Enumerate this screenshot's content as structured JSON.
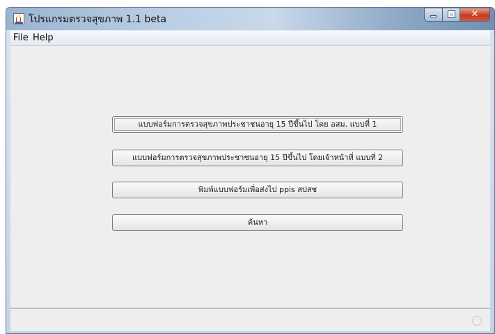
{
  "window": {
    "title": "โปรแกรมตรวจสุขภาพ 1.1 beta",
    "app_icon": "java-cup-icon",
    "controls": {
      "minimize": "minimize-icon",
      "maximize": "maximize-icon",
      "close": "close-icon",
      "close_glyph": "✕"
    }
  },
  "menu": {
    "items": [
      {
        "label": "File"
      },
      {
        "label": "Help"
      }
    ]
  },
  "main": {
    "buttons": [
      {
        "label": "แบบฟอร์มการตรวจสุขภาพประชาชนอายุ 15 ปีขึ้นไป โดย อสม. แบบที่ 1"
      },
      {
        "label": "แบบฟอร์มการตรวจสุขภาพประชาชนอายุ 15 ปีขึ้นไป โดยเจ้าหน้าที่ แบบที่ 2"
      },
      {
        "label": "พิมพ์แบบฟอร์มเพื่อส่งไป ppis สปสช"
      },
      {
        "label": "ค้นหา"
      }
    ]
  },
  "status": {
    "busy_icon": "busy-indicator-icon"
  }
}
